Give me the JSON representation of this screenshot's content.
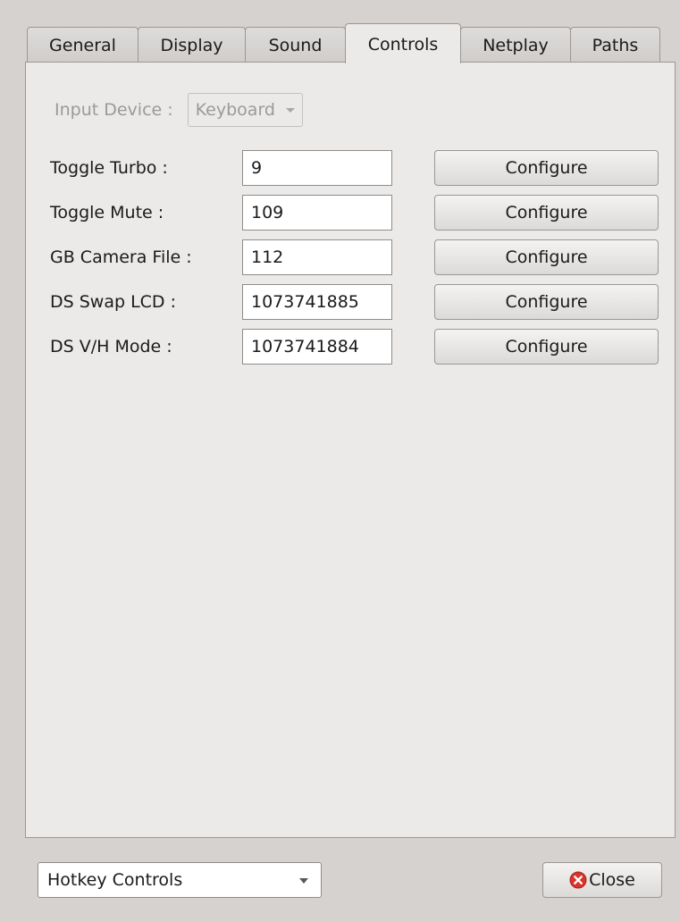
{
  "tabs": [
    {
      "label": "General"
    },
    {
      "label": "Display"
    },
    {
      "label": "Sound"
    },
    {
      "label": "Controls"
    },
    {
      "label": "Netplay"
    },
    {
      "label": "Paths"
    }
  ],
  "active_tab": "Controls",
  "input_device": {
    "label": "Input Device :",
    "value": "Keyboard"
  },
  "hotkeys": [
    {
      "label": "Toggle Turbo :",
      "value": "9",
      "button": "Configure"
    },
    {
      "label": "Toggle Mute :",
      "value": "109",
      "button": "Configure"
    },
    {
      "label": "GB Camera File :",
      "value": "112",
      "button": "Configure"
    },
    {
      "label": "DS Swap LCD :",
      "value": "1073741885",
      "button": "Configure"
    },
    {
      "label": "DS V/H Mode :",
      "value": "1073741884",
      "button": "Configure"
    }
  ],
  "mode_select": {
    "value": "Hotkey Controls"
  },
  "close_button": {
    "label": "Close",
    "icon": "close-icon",
    "icon_color": "#d9342b"
  }
}
